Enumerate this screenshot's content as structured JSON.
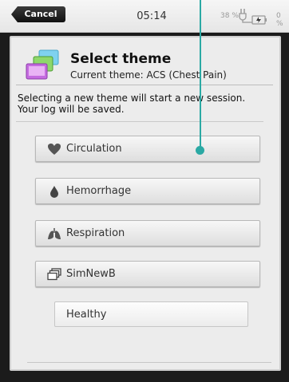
{
  "status_bar": {
    "cancel_label": "Cancel",
    "time": "05:14",
    "battery_percent": "38 %",
    "overflow_text": "0 %"
  },
  "dialog": {
    "title": "Select theme",
    "current_theme": "Current theme: ACS (Chest Pain)",
    "info_line1": "Selecting a new theme will start a new session.",
    "info_line2": "Your log will be saved.",
    "options": [
      {
        "label": "Circulation",
        "icon": "heart-icon"
      },
      {
        "label": "Hemorrhage",
        "icon": "blood-drop-icon"
      },
      {
        "label": "Respiration",
        "icon": "lungs-icon"
      },
      {
        "label": "SimNewB",
        "icon": "windows-stack-icon"
      },
      {
        "label": "Healthy",
        "icon": ""
      }
    ]
  },
  "colors": {
    "accent": "#2ba9a4",
    "dialog_bg": "#ececec",
    "button_border": "#b8b8b8"
  }
}
